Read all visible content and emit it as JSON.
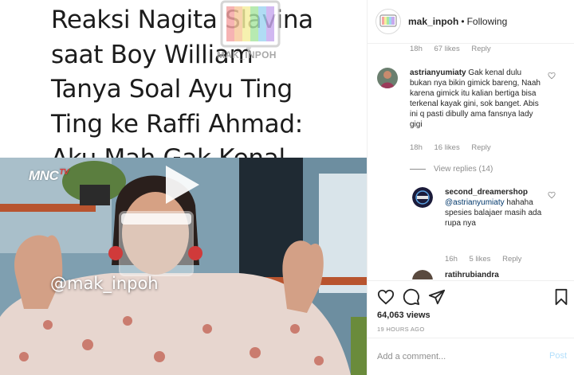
{
  "post": {
    "headline": "Reaksi Nagita Slavina\nsaat Boy William\nTanya Soal Ayu Ting\nTing ke Raffi Ahmad:\nAku Mah Gak Kenal",
    "logo_text": "MAK_INPOH",
    "channel_logo": "MNC",
    "channel_logo_suffix": "TV",
    "video_watermark": "@mak_inpoh"
  },
  "header": {
    "username": "mak_inpoh",
    "separator": "•",
    "follow_label": "Following"
  },
  "top_comment_meta": {
    "age": "18h",
    "likes": "67 likes",
    "reply": "Reply"
  },
  "comments": [
    {
      "username": "astrianyumiaty",
      "text": "Gak kenal dulu bukan nya bikin gimick bareng, Naah karena gimick itu kalian bertiga bisa terkenal kayak gini, sok banget. Abis ini q pasti dibully ama fansnya lady gigi",
      "age": "18h",
      "likes": "16 likes",
      "reply": "Reply",
      "view_replies": "View replies (14)"
    }
  ],
  "replies": [
    {
      "username": "second_dreamershop",
      "mention": "@astrianyumiaty",
      "text": "hahaha spesies balajaer masih ada rupa nya",
      "age": "16h",
      "likes": "5 likes",
      "reply": "Reply"
    },
    {
      "username": "ratihrubiandra"
    }
  ],
  "stats": {
    "views": "64,063 views",
    "age": "19 HOURS AGO"
  },
  "add_comment": {
    "placeholder": "Add a comment...",
    "post_label": "Post"
  },
  "colors": {
    "text": "#262626",
    "muted": "#8e8e8e",
    "link": "#00376b",
    "post_disabled": "#b2dffc",
    "divider": "#efefef"
  }
}
